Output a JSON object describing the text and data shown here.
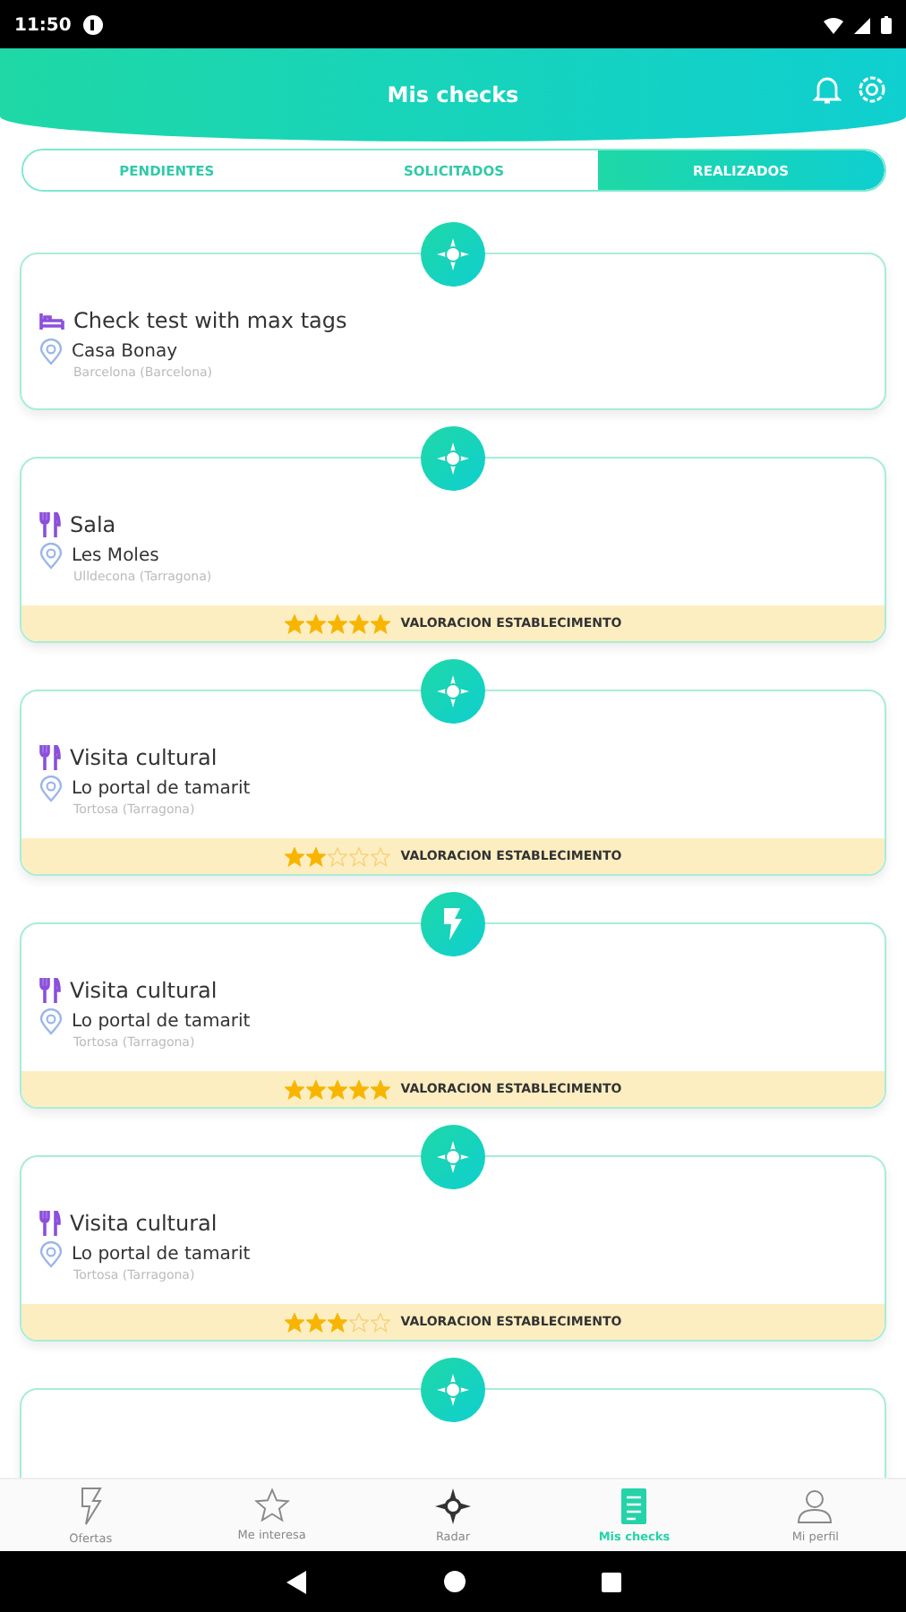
{
  "status_bar": {
    "time": "11:50"
  },
  "header": {
    "title": "Mis checks"
  },
  "tabs": [
    {
      "label": "PENDIENTES",
      "selected": false
    },
    {
      "label": "SOLICITADOS",
      "selected": false
    },
    {
      "label": "REALIZADOS",
      "selected": true
    }
  ],
  "checks": [
    {
      "badge": {
        "kind": "radar"
      },
      "category": {
        "kind": "bed"
      },
      "title": "Check test with max tags",
      "place": "Casa Bonay",
      "city": "Barcelona (Barcelona)"
    },
    {
      "badge": {
        "kind": "radar"
      },
      "category": {
        "kind": "food"
      },
      "title": "Sala",
      "place": "Les Moles",
      "city": "Ulldecona (Tarragona)",
      "stars": 5,
      "rating_label": "VALORACION ESTABLECIMENTO"
    },
    {
      "badge": {
        "kind": "radar"
      },
      "category": {
        "kind": "food"
      },
      "title": "Visita cultural",
      "place": "Lo portal de tamarit",
      "city": "Tortosa (Tarragona)",
      "stars": 2,
      "rating_label": "VALORACION ESTABLECIMENTO"
    },
    {
      "badge": {
        "kind": "bolt"
      },
      "category": {
        "kind": "food"
      },
      "title": "Visita cultural",
      "place": "Lo portal de tamarit",
      "city": "Tortosa (Tarragona)",
      "stars": 5,
      "rating_label": "VALORACION ESTABLECIMENTO"
    },
    {
      "badge": {
        "kind": "radar"
      },
      "category": {
        "kind": "food"
      },
      "title": "Visita cultural",
      "place": "Lo portal de tamarit",
      "city": "Tortosa (Tarragona)",
      "stars": 3,
      "rating_label": "VALORACION ESTABLECIMENTO"
    },
    {
      "badge": {
        "kind": "radar"
      }
    }
  ],
  "nav": [
    {
      "kind": "bolt",
      "label": "Ofertas",
      "selected": false
    },
    {
      "kind": "star",
      "label": "Me interesa",
      "selected": false
    },
    {
      "kind": "radar",
      "label": "Radar",
      "selected": false
    },
    {
      "kind": "list",
      "label": "Mis checks",
      "selected": true
    },
    {
      "kind": "user",
      "label": "Mi perfil",
      "selected": false
    }
  ]
}
